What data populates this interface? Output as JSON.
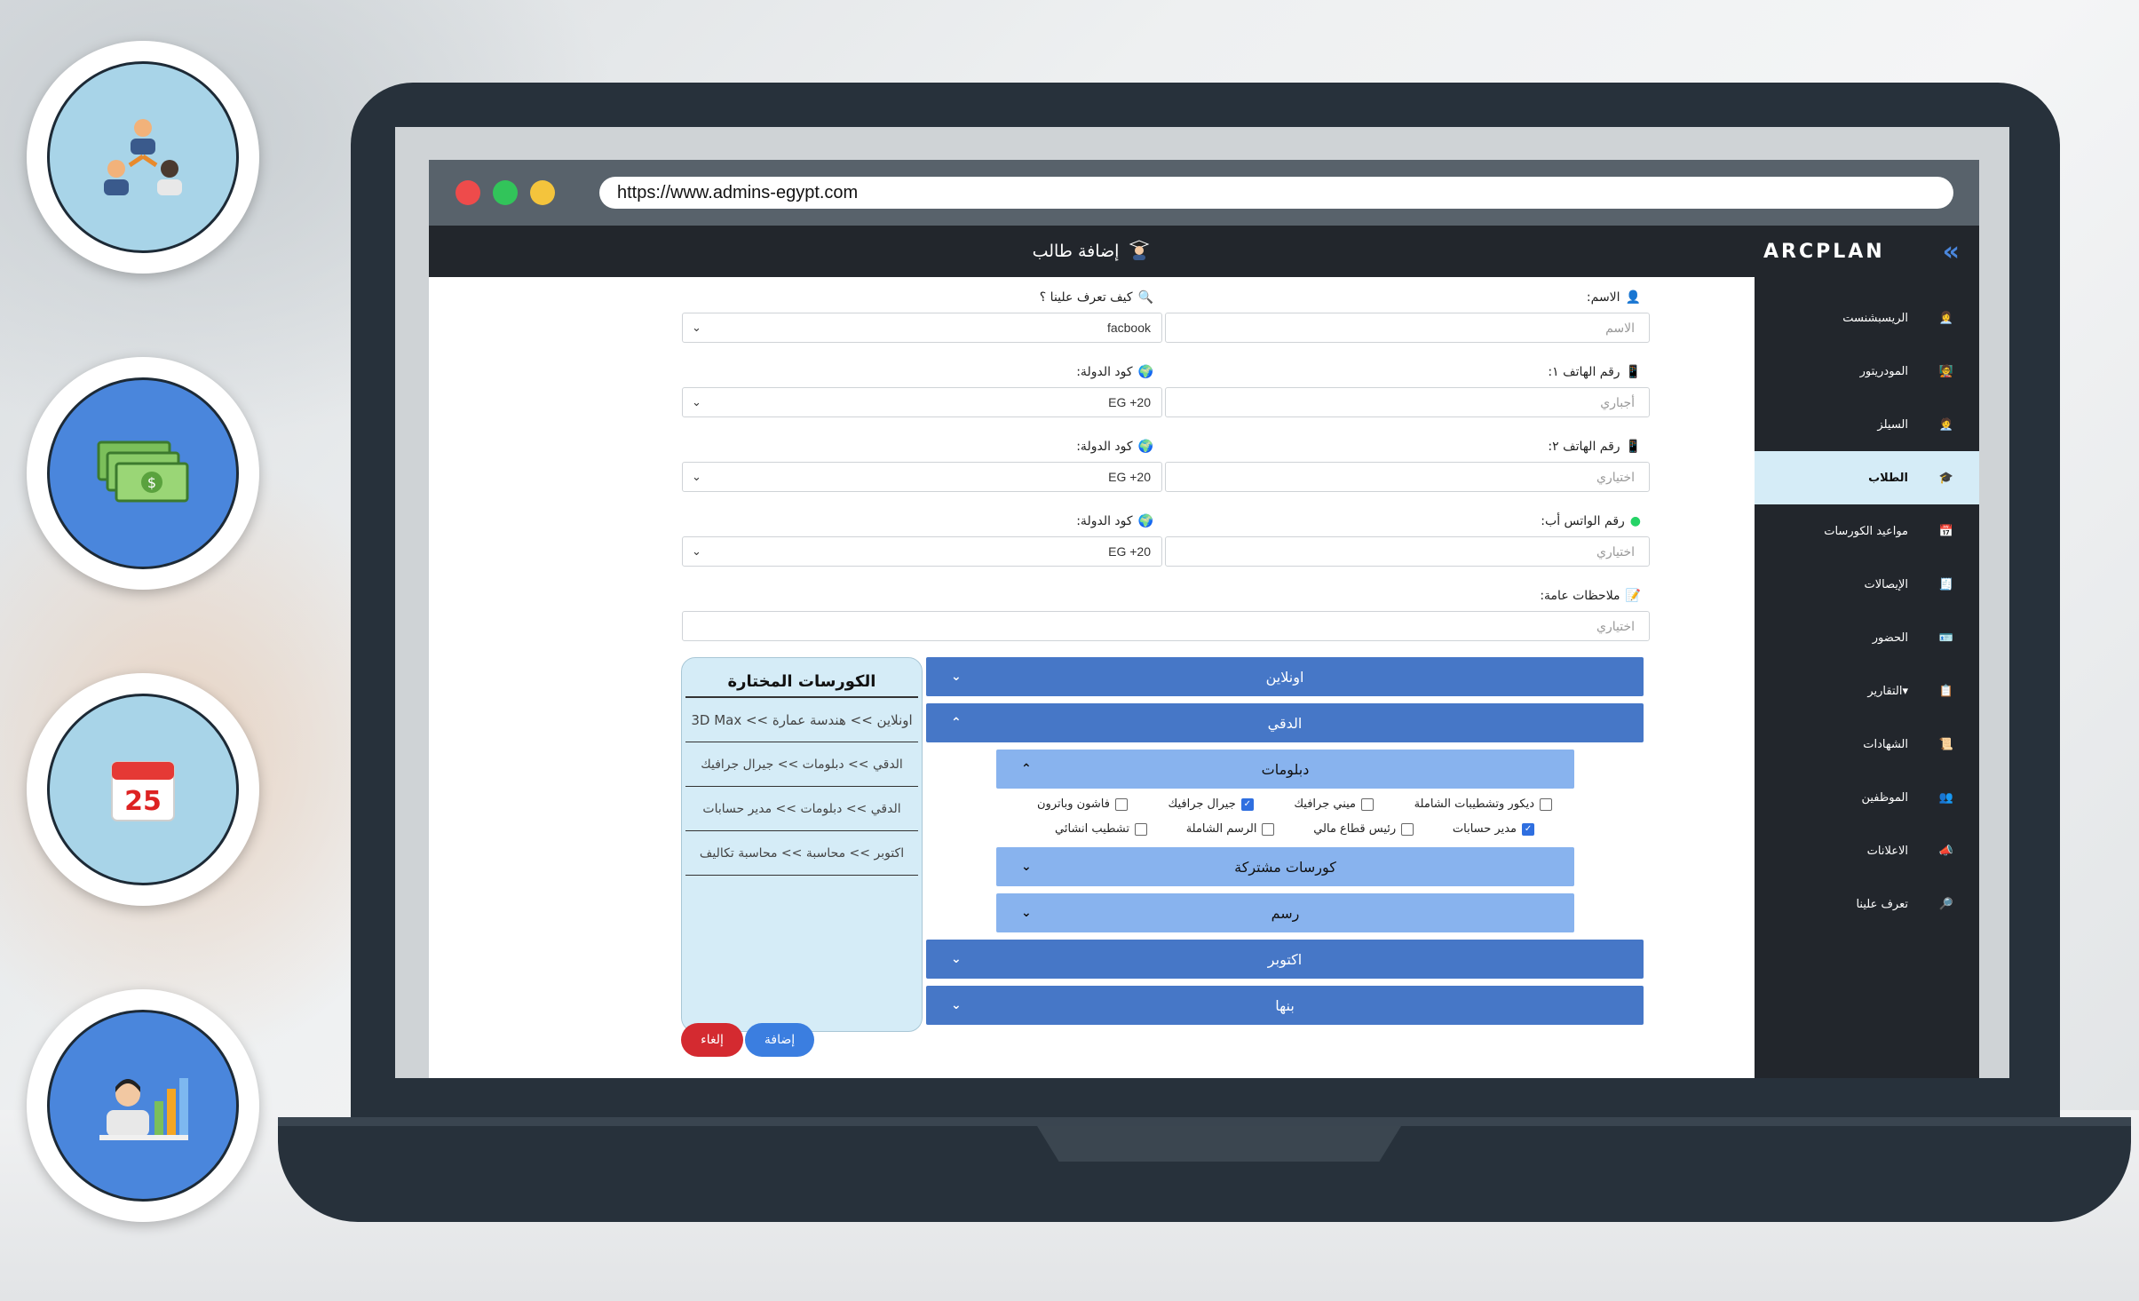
{
  "browser": {
    "url": "https://www.admins-egypt.com"
  },
  "app": {
    "brand": "ARCPLAN",
    "page_title": "إضافة طالب"
  },
  "sidebar": {
    "items": [
      {
        "label": "الريسبشنست",
        "icon": "receptionist-icon"
      },
      {
        "label": "المودريتور",
        "icon": "moderator-icon"
      },
      {
        "label": "السيلز",
        "icon": "sales-icon"
      },
      {
        "label": "الطلاب",
        "icon": "students-icon",
        "active": true
      },
      {
        "label": "مواعيد الكورسات",
        "icon": "calendar-icon"
      },
      {
        "label": "الإيصالات",
        "icon": "receipts-icon"
      },
      {
        "label": "الحضور",
        "icon": "attendance-icon"
      },
      {
        "label": "التقارير▾",
        "icon": "reports-icon"
      },
      {
        "label": "الشهادات",
        "icon": "certificates-icon"
      },
      {
        "label": "الموظفين",
        "icon": "employees-icon"
      },
      {
        "label": "الاعلانات",
        "icon": "megaphone-icon"
      },
      {
        "label": "تعرف علينا",
        "icon": "search-doc-icon"
      }
    ]
  },
  "form": {
    "name_label": "الاسم:",
    "name_placeholder": "الاسم",
    "source_label": "كيف تعرف علينا ؟",
    "source_value": "facbook",
    "phone1_label": "رقم الهاتف ١:",
    "phone1_placeholder": "أجباري",
    "phone2_label": "رقم الهاتف ٢:",
    "phone2_placeholder": "اختياري",
    "whatsapp_label": "رقم الواتس أب:",
    "whatsapp_placeholder": "اختياري",
    "country_label": "كود الدولة:",
    "country_value": "EG +20",
    "notes_label": "ملاحظات عامة:",
    "notes_placeholder": "اختياري"
  },
  "selected_courses": {
    "title": "الكورسات المختارة",
    "items": [
      "اونلاين >> هندسة عمارة >> 3D Max",
      "الدقي >> دبلومات >> جيرال جرافيك",
      "الدقي >> دبلومات >> مدير حسابات",
      "اكتوبر >> محاسبة >> محاسبة تكاليف"
    ]
  },
  "accordion": {
    "online": "اونلاين",
    "dokki": "الدقي",
    "diplomas": "دبلومات",
    "shared_courses": "كورسات مشتركة",
    "drawing": "رسم",
    "october": "اكتوبر",
    "banha": "بنها"
  },
  "checkboxes": {
    "row1": [
      {
        "label": "ديكور وتشطيبات الشاملة",
        "checked": false
      },
      {
        "label": "ميني جرافيك",
        "checked": false
      },
      {
        "label": "جيرال جرافيك",
        "checked": true
      },
      {
        "label": "فاشون وباترون",
        "checked": false
      }
    ],
    "row2": [
      {
        "label": "مدير حسابات",
        "checked": true
      },
      {
        "label": "رئيس قطاع مالي",
        "checked": false
      },
      {
        "label": "الرسم الشاملة",
        "checked": false
      },
      {
        "label": "تشطيب انشائي",
        "checked": false
      }
    ]
  },
  "buttons": {
    "add": "إضافة",
    "cancel": "إلغاء"
  },
  "colors": {
    "sidebar": "#22262c",
    "accent": "#4677c7",
    "active": "#d5ecf7",
    "cancel": "#d42a30"
  }
}
